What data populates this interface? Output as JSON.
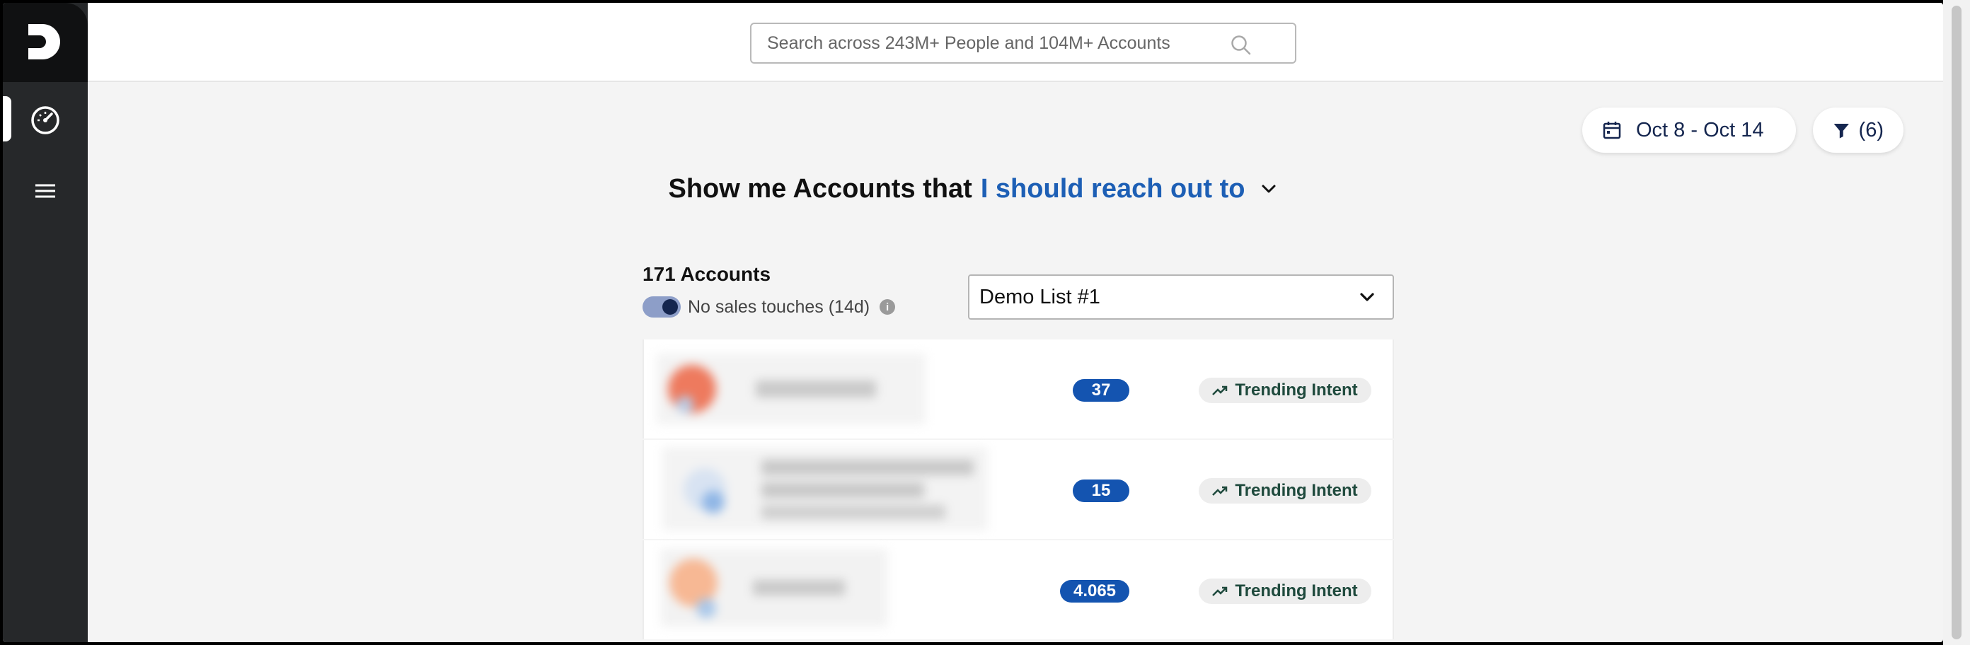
{
  "search": {
    "placeholder": "Search across 243M+ People and 104M+ Accounts",
    "icon": "search-icon"
  },
  "header": {
    "date_range": "Oct 8 - Oct 14",
    "filter_count": "(6)"
  },
  "headline": {
    "lead": "Show me Accounts that",
    "choice": "I should reach out to"
  },
  "accounts": {
    "count_label": "171 Accounts",
    "toggle_label": "No sales touches (14d)",
    "toggle_on": true,
    "selected_list": "Demo List #1"
  },
  "rows": [
    {
      "score": "37",
      "tag": "Trending Intent"
    },
    {
      "score": "15",
      "tag": "Trending Intent"
    },
    {
      "score": "4.065",
      "tag": "Trending Intent"
    }
  ],
  "colors": {
    "sidebar": "#26282a",
    "accent_blue": "#1d5fb5",
    "score_badge": "#1454b0",
    "navy": "#15264f"
  }
}
